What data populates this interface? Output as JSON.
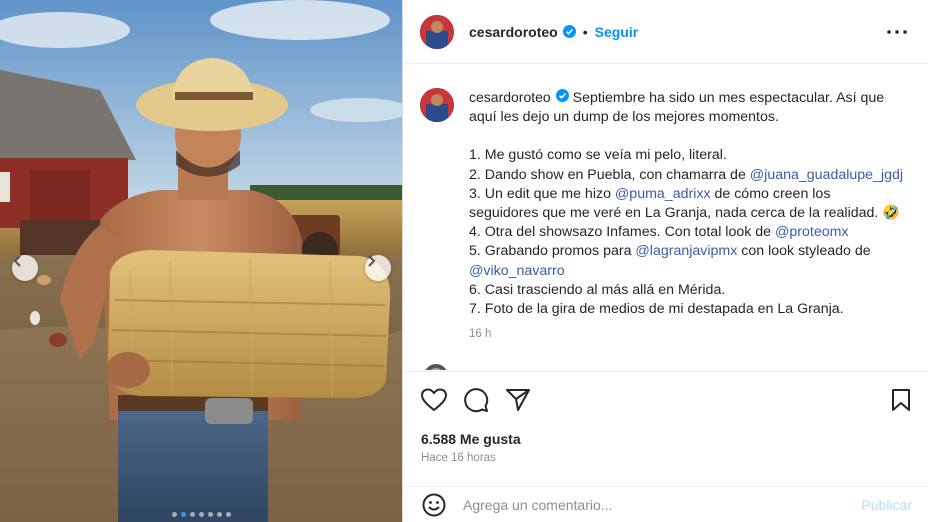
{
  "post": {
    "username": "cesardoroteo",
    "follow_label": "Seguir",
    "separator": "•"
  },
  "caption": {
    "username": "cesardoroteo",
    "intro_1": "Septiembre ha sido un mes espectacular. Así que",
    "intro_2": "aquí les dejo un dump de los mejores momentos.",
    "item1": "1. Me gustó como se veía mi pelo, literal.",
    "item2_text": "2. Dando show en Puebla, con chamarra de ",
    "item2_mention": "@juana_guadalupe_jgdj",
    "item3_text": "3. Un edit que me hizo ",
    "item3_mention": "@puma_adrixx",
    "item3_rest": " de cómo creen los",
    "item3_cont": "seguidores que me veré en La Granja, nada cerca de la realidad. 🤣",
    "item4_text": "4. Otra del showsazo Infames. Con total look de ",
    "item4_mention": "@proteomx",
    "item5_text": "5. Grabando promos para ",
    "item5_mention": "@lagranjavipmx",
    "item5_rest": " con look styleado de",
    "item5_mention2": "@viko_navarro",
    "item6": "6. Casi trasciendo al más allá en Mérida.",
    "item7": "7. Foto de la gira de medios de mi destapada en La Granja.",
    "time": "16 h"
  },
  "actions": {
    "like_icon": "heart-icon",
    "comment_icon": "comment-icon",
    "share_icon": "send-icon",
    "save_icon": "bookmark-icon"
  },
  "stats": {
    "likes": "6.588 Me gusta",
    "posted": "Hace 16 horas"
  },
  "comment_box": {
    "placeholder": "Agrega un comentario...",
    "publish_label": "Publicar",
    "emoji_icon": "smiley-icon"
  },
  "carousel": {
    "slide_count": 7,
    "active_index": 1
  },
  "colors": {
    "link": "#0095f6",
    "mention": "#3b5ca8",
    "verified": "#0095f6",
    "publish_disabled": "#b2dffc"
  }
}
